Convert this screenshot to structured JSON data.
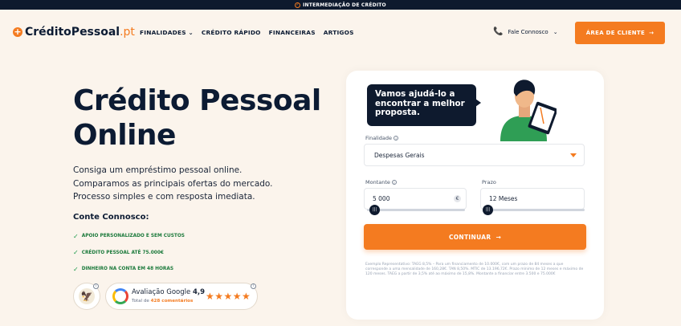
{
  "topbar": {
    "text": "INTERMEDIAÇÃO DE CRÉDITO",
    "icon": "check-circle-icon"
  },
  "header": {
    "logo_main": "CréditoPessoal",
    "logo_suffix": ".pt",
    "menu": [
      "FINALIDADES",
      "CRÉDITO RÁPIDO",
      "FINANCEIRAS",
      "ARTIGOS"
    ],
    "contact_label": "Fale Connosco",
    "cta_label": "ÁREA DE CLIENTE"
  },
  "hero": {
    "title_line1": "Crédito Pessoal",
    "title_line2": "Online",
    "sub_line1": "Consiga um empréstimo pessoal online.",
    "sub_line2": "Comparamos as principais ofertas do mercado.",
    "sub_line3": "Processo simples e com resposta imediata.",
    "contact_title": "Conte Connosco:",
    "checks": [
      "APOIO PERSONALIZADO E SEM CUSTOS",
      "CRÉDITO PESSOAL ATÉ 75.000€",
      "DINHEIRO NA CONTA EM 48 HORAS"
    ]
  },
  "google": {
    "label": "Avaliação Google",
    "rating": "4,9",
    "total_prefix": "Total de",
    "total_count": "428 comentários",
    "stars": 5
  },
  "form": {
    "bubble": "Vamos ajudá-lo a encontrar a melhor proposta.",
    "finalidade_label": "Finalidade",
    "finalidade_value": "Despesas Gerais",
    "montante_label": "Montante",
    "montante_value": "5 000",
    "prazo_label": "Prazo",
    "prazo_value": "12 Meses",
    "continue_label": "CONTINUAR",
    "fine_print": "Exemplo Representativo: TAEG 8,5% – Para um financiamento de 10.000€, com um prazo de 84 meses a que corresponde a uma mensalidade de 160,28€. TAN 8,50%. MTIC de 13.196,72€. Prazo mínimo de 12 meses e máximo de 120 meses. TAEG a partir de 3,5% até ao máximo de 15,8%. Montante a financiar entre 3.500 e 75.000€"
  },
  "colors": {
    "accent": "#f47b20",
    "navy": "#0e1a2e",
    "background": "#fbf4ec",
    "green": "#1c7a3c"
  }
}
